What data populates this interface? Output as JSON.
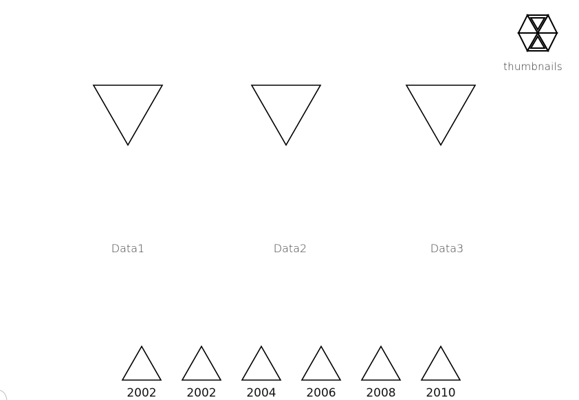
{
  "toolbar": {
    "thumbnails_label": "thumbnails",
    "thumbnails_icon": "hexagon-triangles-icon"
  },
  "datasets": [
    {
      "label": "Data1",
      "icon": "triangle-down-icon"
    },
    {
      "label": "Data2",
      "icon": "triangle-down-icon"
    },
    {
      "label": "Data3",
      "icon": "triangle-down-icon"
    }
  ],
  "timeline": {
    "years": [
      {
        "label": "2002",
        "icon": "triangle-up-icon"
      },
      {
        "label": "2002",
        "icon": "triangle-up-icon"
      },
      {
        "label": "2004",
        "icon": "triangle-up-icon"
      },
      {
        "label": "2006",
        "icon": "triangle-up-icon"
      },
      {
        "label": "2008",
        "icon": "triangle-up-icon"
      },
      {
        "label": "2010",
        "icon": "triangle-up-icon"
      }
    ]
  },
  "colors": {
    "background": "#ffffff",
    "stroke": "#000000",
    "label_text": "#444444"
  }
}
